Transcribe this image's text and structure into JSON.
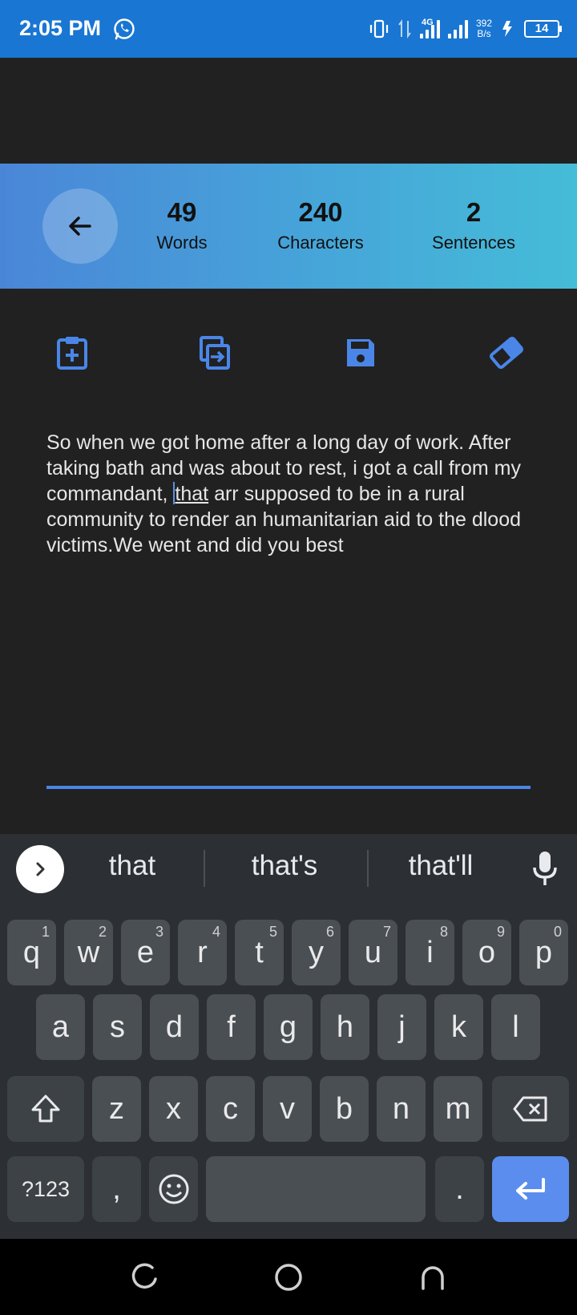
{
  "status_bar": {
    "time": "2:05 PM",
    "network": "4G",
    "speed_top": "392",
    "speed_bottom": "B/s",
    "battery": "14"
  },
  "stats": {
    "words_count": "49",
    "words_label": "Words",
    "characters_count": "240",
    "characters_label": "Characters",
    "sentences_count": "2",
    "sentences_label": "Sentences"
  },
  "toolbar": {
    "icons": [
      "clipboard-add-icon",
      "copy-icon",
      "save-icon",
      "eraser-icon"
    ]
  },
  "editor": {
    "text_before": "So when we got home after a long day of work. After taking bath and was about to rest, i got a call from my commandant, ",
    "text_underlined": "that",
    "text_after": " arr supposed to be in a rural community to render an humanitarian aid to the dlood victims.We went and did you best"
  },
  "keyboard": {
    "suggestions": [
      "that",
      "that's",
      "that'll"
    ],
    "row1": [
      {
        "key": "q",
        "hint": "1"
      },
      {
        "key": "w",
        "hint": "2"
      },
      {
        "key": "e",
        "hint": "3"
      },
      {
        "key": "r",
        "hint": "4"
      },
      {
        "key": "t",
        "hint": "5"
      },
      {
        "key": "y",
        "hint": "6"
      },
      {
        "key": "u",
        "hint": "7"
      },
      {
        "key": "i",
        "hint": "8"
      },
      {
        "key": "o",
        "hint": "9"
      },
      {
        "key": "p",
        "hint": "0"
      }
    ],
    "row2": [
      "a",
      "s",
      "d",
      "f",
      "g",
      "h",
      "j",
      "k",
      "l"
    ],
    "row3": [
      "z",
      "x",
      "c",
      "v",
      "b",
      "n",
      "m"
    ],
    "symbols_label": "?123",
    "comma": ",",
    "period": "."
  },
  "colors": {
    "status_bar": "#1976d2",
    "accent": "#4a86e8",
    "background": "#212121",
    "keyboard": "#2c3034"
  }
}
